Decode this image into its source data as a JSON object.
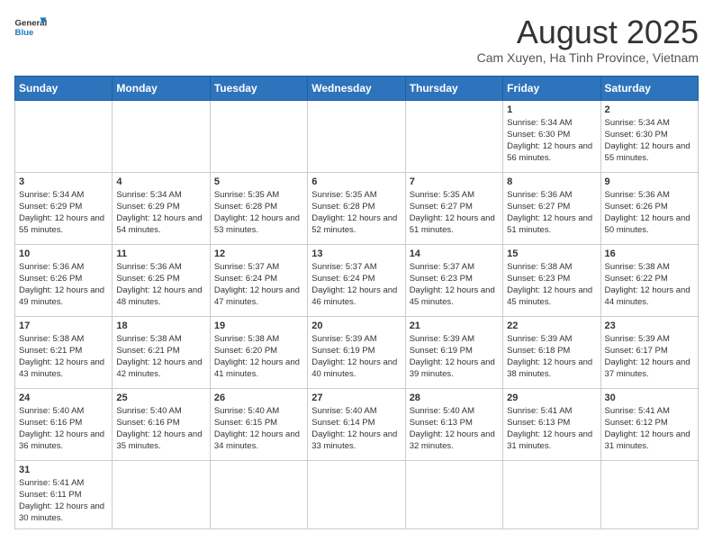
{
  "header": {
    "logo_general": "General",
    "logo_blue": "Blue",
    "title": "August 2025",
    "subtitle": "Cam Xuyen, Ha Tinh Province, Vietnam"
  },
  "weekdays": [
    "Sunday",
    "Monday",
    "Tuesday",
    "Wednesday",
    "Thursday",
    "Friday",
    "Saturday"
  ],
  "weeks": [
    [
      {
        "day": "",
        "info": ""
      },
      {
        "day": "",
        "info": ""
      },
      {
        "day": "",
        "info": ""
      },
      {
        "day": "",
        "info": ""
      },
      {
        "day": "",
        "info": ""
      },
      {
        "day": "1",
        "info": "Sunrise: 5:34 AM\nSunset: 6:30 PM\nDaylight: 12 hours and 56 minutes."
      },
      {
        "day": "2",
        "info": "Sunrise: 5:34 AM\nSunset: 6:30 PM\nDaylight: 12 hours and 55 minutes."
      }
    ],
    [
      {
        "day": "3",
        "info": "Sunrise: 5:34 AM\nSunset: 6:29 PM\nDaylight: 12 hours and 55 minutes."
      },
      {
        "day": "4",
        "info": "Sunrise: 5:34 AM\nSunset: 6:29 PM\nDaylight: 12 hours and 54 minutes."
      },
      {
        "day": "5",
        "info": "Sunrise: 5:35 AM\nSunset: 6:28 PM\nDaylight: 12 hours and 53 minutes."
      },
      {
        "day": "6",
        "info": "Sunrise: 5:35 AM\nSunset: 6:28 PM\nDaylight: 12 hours and 52 minutes."
      },
      {
        "day": "7",
        "info": "Sunrise: 5:35 AM\nSunset: 6:27 PM\nDaylight: 12 hours and 51 minutes."
      },
      {
        "day": "8",
        "info": "Sunrise: 5:36 AM\nSunset: 6:27 PM\nDaylight: 12 hours and 51 minutes."
      },
      {
        "day": "9",
        "info": "Sunrise: 5:36 AM\nSunset: 6:26 PM\nDaylight: 12 hours and 50 minutes."
      }
    ],
    [
      {
        "day": "10",
        "info": "Sunrise: 5:36 AM\nSunset: 6:26 PM\nDaylight: 12 hours and 49 minutes."
      },
      {
        "day": "11",
        "info": "Sunrise: 5:36 AM\nSunset: 6:25 PM\nDaylight: 12 hours and 48 minutes."
      },
      {
        "day": "12",
        "info": "Sunrise: 5:37 AM\nSunset: 6:24 PM\nDaylight: 12 hours and 47 minutes."
      },
      {
        "day": "13",
        "info": "Sunrise: 5:37 AM\nSunset: 6:24 PM\nDaylight: 12 hours and 46 minutes."
      },
      {
        "day": "14",
        "info": "Sunrise: 5:37 AM\nSunset: 6:23 PM\nDaylight: 12 hours and 45 minutes."
      },
      {
        "day": "15",
        "info": "Sunrise: 5:38 AM\nSunset: 6:23 PM\nDaylight: 12 hours and 45 minutes."
      },
      {
        "day": "16",
        "info": "Sunrise: 5:38 AM\nSunset: 6:22 PM\nDaylight: 12 hours and 44 minutes."
      }
    ],
    [
      {
        "day": "17",
        "info": "Sunrise: 5:38 AM\nSunset: 6:21 PM\nDaylight: 12 hours and 43 minutes."
      },
      {
        "day": "18",
        "info": "Sunrise: 5:38 AM\nSunset: 6:21 PM\nDaylight: 12 hours and 42 minutes."
      },
      {
        "day": "19",
        "info": "Sunrise: 5:38 AM\nSunset: 6:20 PM\nDaylight: 12 hours and 41 minutes."
      },
      {
        "day": "20",
        "info": "Sunrise: 5:39 AM\nSunset: 6:19 PM\nDaylight: 12 hours and 40 minutes."
      },
      {
        "day": "21",
        "info": "Sunrise: 5:39 AM\nSunset: 6:19 PM\nDaylight: 12 hours and 39 minutes."
      },
      {
        "day": "22",
        "info": "Sunrise: 5:39 AM\nSunset: 6:18 PM\nDaylight: 12 hours and 38 minutes."
      },
      {
        "day": "23",
        "info": "Sunrise: 5:39 AM\nSunset: 6:17 PM\nDaylight: 12 hours and 37 minutes."
      }
    ],
    [
      {
        "day": "24",
        "info": "Sunrise: 5:40 AM\nSunset: 6:16 PM\nDaylight: 12 hours and 36 minutes."
      },
      {
        "day": "25",
        "info": "Sunrise: 5:40 AM\nSunset: 6:16 PM\nDaylight: 12 hours and 35 minutes."
      },
      {
        "day": "26",
        "info": "Sunrise: 5:40 AM\nSunset: 6:15 PM\nDaylight: 12 hours and 34 minutes."
      },
      {
        "day": "27",
        "info": "Sunrise: 5:40 AM\nSunset: 6:14 PM\nDaylight: 12 hours and 33 minutes."
      },
      {
        "day": "28",
        "info": "Sunrise: 5:40 AM\nSunset: 6:13 PM\nDaylight: 12 hours and 32 minutes."
      },
      {
        "day": "29",
        "info": "Sunrise: 5:41 AM\nSunset: 6:13 PM\nDaylight: 12 hours and 31 minutes."
      },
      {
        "day": "30",
        "info": "Sunrise: 5:41 AM\nSunset: 6:12 PM\nDaylight: 12 hours and 31 minutes."
      }
    ],
    [
      {
        "day": "31",
        "info": "Sunrise: 5:41 AM\nSunset: 6:11 PM\nDaylight: 12 hours and 30 minutes."
      },
      {
        "day": "",
        "info": ""
      },
      {
        "day": "",
        "info": ""
      },
      {
        "day": "",
        "info": ""
      },
      {
        "day": "",
        "info": ""
      },
      {
        "day": "",
        "info": ""
      },
      {
        "day": "",
        "info": ""
      }
    ]
  ]
}
